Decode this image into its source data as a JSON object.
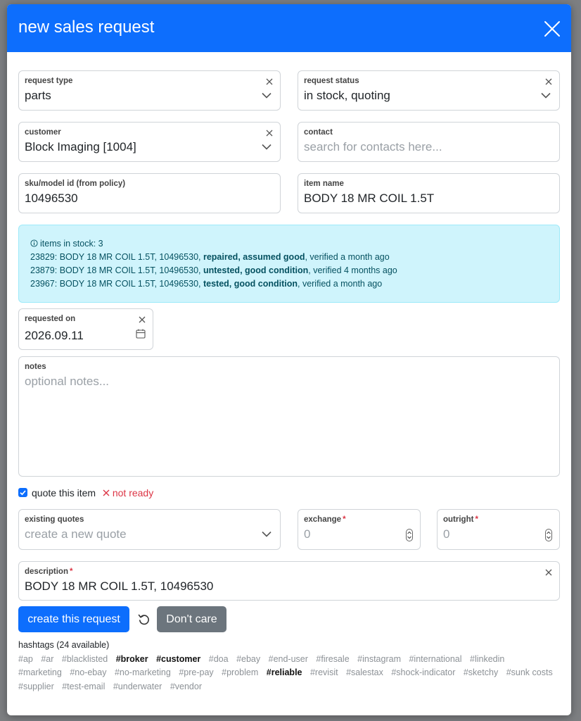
{
  "modal": {
    "title": "new sales request"
  },
  "form": {
    "request_type": {
      "label": "request type",
      "value": "parts"
    },
    "request_status": {
      "label": "request status",
      "value": "in stock, quoting"
    },
    "customer": {
      "label": "customer",
      "value": "Block Imaging [1004]"
    },
    "contact": {
      "label": "contact",
      "placeholder": "search for contacts here..."
    },
    "sku": {
      "label": "sku/model id (from policy)",
      "value": "10496530"
    },
    "item_name": {
      "label": "item name",
      "value": "BODY 18 MR COIL 1.5T"
    },
    "requested_on": {
      "label": "requested on",
      "value": "2026.09.11"
    },
    "notes": {
      "label": "notes",
      "placeholder": "optional notes..."
    },
    "existing_quotes": {
      "label": "existing quotes",
      "placeholder": "create a new quote"
    },
    "exchange": {
      "label": "exchange",
      "required": "*",
      "value": "0"
    },
    "outright": {
      "label": "outright",
      "required": "*",
      "value": "0"
    },
    "description": {
      "label": "description",
      "required": "*",
      "value": "BODY 18 MR COIL 1.5T, 10496530"
    }
  },
  "stock_alert": {
    "header": "items in stock: 3",
    "items": [
      {
        "prefix": "23829: BODY 18 MR COIL 1.5T, 10496530, ",
        "condition": "repaired, assumed good",
        "suffix": ", verified a month ago"
      },
      {
        "prefix": "23879: BODY 18 MR COIL 1.5T, 10496530, ",
        "condition": "untested, good condition",
        "suffix": ", verified 4 months ago"
      },
      {
        "prefix": "23967: BODY 18 MR COIL 1.5T, 10496530, ",
        "condition": "tested, good condition",
        "suffix": ", verified a month ago"
      }
    ]
  },
  "quote": {
    "checkbox_label": "quote this item",
    "status": "not ready",
    "checked": true
  },
  "buttons": {
    "create": "create this request",
    "dont_care": "Don't care"
  },
  "hashtags": {
    "title": "hashtags (24 available)",
    "tags": [
      {
        "text": "#ap",
        "bold": false
      },
      {
        "text": "#ar",
        "bold": false
      },
      {
        "text": "#blacklisted",
        "bold": false
      },
      {
        "text": "#broker",
        "bold": true
      },
      {
        "text": "#customer",
        "bold": true
      },
      {
        "text": "#doa",
        "bold": false
      },
      {
        "text": "#ebay",
        "bold": false
      },
      {
        "text": "#end-user",
        "bold": false
      },
      {
        "text": "#firesale",
        "bold": false
      },
      {
        "text": "#instagram",
        "bold": false
      },
      {
        "text": "#international",
        "bold": false
      },
      {
        "text": "#linkedin",
        "bold": false
      },
      {
        "text": "#marketing",
        "bold": false
      },
      {
        "text": "#no-ebay",
        "bold": false
      },
      {
        "text": "#no-marketing",
        "bold": false
      },
      {
        "text": "#pre-pay",
        "bold": false
      },
      {
        "text": "#problem",
        "bold": false
      },
      {
        "text": "#reliable",
        "bold": true
      },
      {
        "text": "#revisit",
        "bold": false
      },
      {
        "text": "#salestax",
        "bold": false
      },
      {
        "text": "#shock-indicator",
        "bold": false
      },
      {
        "text": "#sketchy",
        "bold": false
      },
      {
        "text": "#sunk costs",
        "bold": false
      },
      {
        "text": "#supplier",
        "bold": false
      },
      {
        "text": "#test-email",
        "bold": false
      },
      {
        "text": "#underwater",
        "bold": false
      },
      {
        "text": "#vendor",
        "bold": false
      }
    ]
  },
  "colors": {
    "primary": "#0d6efd",
    "secondary": "#6c757d",
    "info_bg": "#cff4fc",
    "info_text": "#055160",
    "danger": "#dc3545"
  }
}
